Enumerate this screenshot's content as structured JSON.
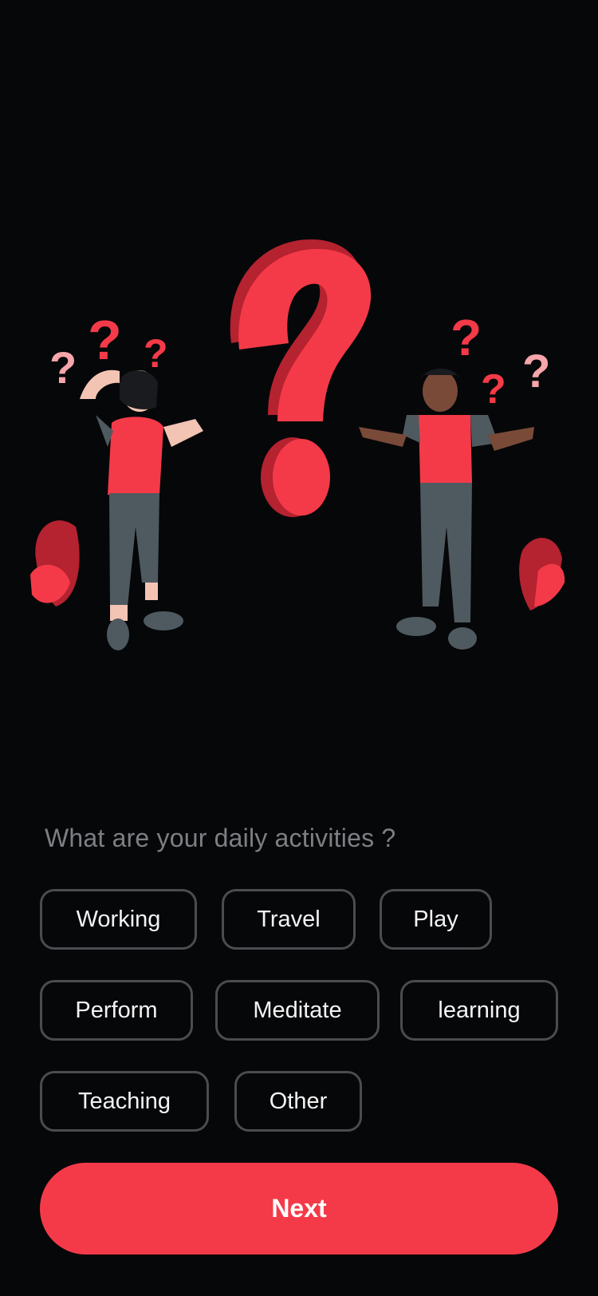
{
  "prompt": {
    "question": "What are your daily activities ?"
  },
  "activities": [
    {
      "label": "Working"
    },
    {
      "label": "Travel"
    },
    {
      "label": "Play"
    },
    {
      "label": "Perform"
    },
    {
      "label": "Meditate"
    },
    {
      "label": "learning"
    },
    {
      "label": "Teaching"
    },
    {
      "label": "Other"
    }
  ],
  "next_button": {
    "label": "Next"
  },
  "colors": {
    "background": "#060709",
    "accent": "#f43a48",
    "chip_border": "#4a4c50",
    "question_text": "#7d7f83"
  }
}
